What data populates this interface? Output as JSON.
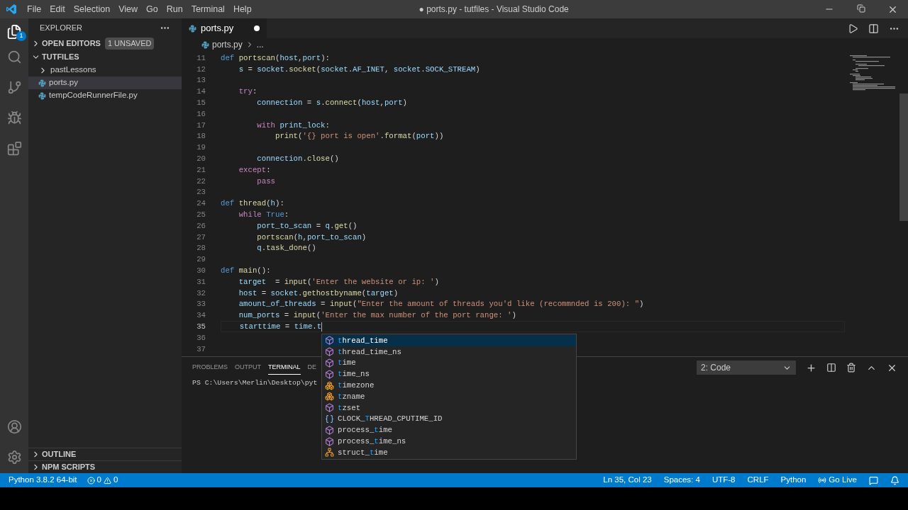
{
  "window": {
    "title": "● ports.py - tutfiles - Visual Studio Code"
  },
  "menu": [
    "File",
    "Edit",
    "Selection",
    "View",
    "Go",
    "Run",
    "Terminal",
    "Help"
  ],
  "activity_badge": "1",
  "sidebar": {
    "header": "EXPLORER",
    "sections": [
      {
        "label": "OPEN EDITORS",
        "expanded": false,
        "badge": "1 UNSAVED"
      },
      {
        "label": "TUTFILES",
        "expanded": true
      }
    ],
    "items": [
      {
        "label": "pastLessons",
        "kind": "folder",
        "selected": false
      },
      {
        "label": "ports.py",
        "kind": "python",
        "selected": true
      },
      {
        "label": "tempCodeRunnerFile.py",
        "kind": "python",
        "selected": false
      }
    ],
    "bottom_sections": [
      {
        "label": "OUTLINE",
        "expanded": false
      },
      {
        "label": "NPM SCRIPTS",
        "expanded": false
      }
    ]
  },
  "tab": {
    "label": "ports.py",
    "dirty": true
  },
  "breadcrumb": [
    "ports.py",
    "..."
  ],
  "code": [
    {
      "n": "11",
      "tokens": [
        {
          "kind": "keyword",
          "text": "def "
        },
        {
          "kind": "function",
          "text": "portscan"
        },
        {
          "kind": "plain",
          "text": "("
        },
        {
          "kind": "variable",
          "text": "host"
        },
        {
          "kind": "plain",
          "text": ","
        },
        {
          "kind": "variable",
          "text": "port"
        },
        {
          "kind": "plain",
          "text": "):"
        }
      ]
    },
    {
      "n": "12",
      "tokens": [
        {
          "kind": "variable",
          "text": "    s"
        },
        {
          "kind": "plain",
          "text": " = "
        },
        {
          "kind": "variable",
          "text": "socket"
        },
        {
          "kind": "plain",
          "text": "."
        },
        {
          "kind": "function",
          "text": "socket"
        },
        {
          "kind": "plain",
          "text": "("
        },
        {
          "kind": "variable",
          "text": "socket"
        },
        {
          "kind": "plain",
          "text": "."
        },
        {
          "kind": "variable",
          "text": "AF_INET"
        },
        {
          "kind": "plain",
          "text": ", "
        },
        {
          "kind": "variable",
          "text": "socket"
        },
        {
          "kind": "plain",
          "text": "."
        },
        {
          "kind": "variable",
          "text": "SOCK_STREAM"
        },
        {
          "kind": "plain",
          "text": ")"
        }
      ]
    },
    {
      "n": "13"
    },
    {
      "n": "14",
      "tokens": [
        {
          "kind": "control",
          "text": "    try"
        },
        {
          "kind": "plain",
          "text": ":"
        }
      ]
    },
    {
      "n": "15",
      "tokens": [
        {
          "kind": "variable",
          "text": "        connection"
        },
        {
          "kind": "plain",
          "text": " = "
        },
        {
          "kind": "variable",
          "text": "s"
        },
        {
          "kind": "plain",
          "text": "."
        },
        {
          "kind": "function",
          "text": "connect"
        },
        {
          "kind": "plain",
          "text": "("
        },
        {
          "kind": "variable",
          "text": "host"
        },
        {
          "kind": "plain",
          "text": ","
        },
        {
          "kind": "variable",
          "text": "port"
        },
        {
          "kind": "plain",
          "text": ")"
        }
      ]
    },
    {
      "n": "16"
    },
    {
      "n": "17",
      "tokens": [
        {
          "kind": "control",
          "text": "        with "
        },
        {
          "kind": "variable",
          "text": "print_lock"
        },
        {
          "kind": "plain",
          "text": ":"
        }
      ]
    },
    {
      "n": "18",
      "tokens": [
        {
          "kind": "function",
          "text": "            print"
        },
        {
          "kind": "plain",
          "text": "("
        },
        {
          "kind": "string",
          "text": "'{} port is open'"
        },
        {
          "kind": "plain",
          "text": "."
        },
        {
          "kind": "function",
          "text": "format"
        },
        {
          "kind": "plain",
          "text": "("
        },
        {
          "kind": "variable",
          "text": "port"
        },
        {
          "kind": "plain",
          "text": "))"
        }
      ]
    },
    {
      "n": "19"
    },
    {
      "n": "20",
      "tokens": [
        {
          "kind": "variable",
          "text": "        connection"
        },
        {
          "kind": "plain",
          "text": "."
        },
        {
          "kind": "function",
          "text": "close"
        },
        {
          "kind": "plain",
          "text": "()"
        }
      ]
    },
    {
      "n": "21",
      "tokens": [
        {
          "kind": "control",
          "text": "    except"
        },
        {
          "kind": "plain",
          "text": ":"
        }
      ]
    },
    {
      "n": "22",
      "tokens": [
        {
          "kind": "control",
          "text": "        pass"
        }
      ]
    },
    {
      "n": "23"
    },
    {
      "n": "24",
      "tokens": [
        {
          "kind": "keyword",
          "text": "def "
        },
        {
          "kind": "function",
          "text": "thread"
        },
        {
          "kind": "plain",
          "text": "("
        },
        {
          "kind": "variable",
          "text": "h"
        },
        {
          "kind": "plain",
          "text": "):"
        }
      ]
    },
    {
      "n": "25",
      "tokens": [
        {
          "kind": "control",
          "text": "    while "
        },
        {
          "kind": "keyword",
          "text": "True"
        },
        {
          "kind": "plain",
          "text": ":"
        }
      ]
    },
    {
      "n": "26",
      "tokens": [
        {
          "kind": "variable",
          "text": "        port_to_scan"
        },
        {
          "kind": "plain",
          "text": " = "
        },
        {
          "kind": "variable",
          "text": "q"
        },
        {
          "kind": "plain",
          "text": "."
        },
        {
          "kind": "function",
          "text": "get"
        },
        {
          "kind": "plain",
          "text": "()"
        }
      ]
    },
    {
      "n": "27",
      "tokens": [
        {
          "kind": "function",
          "text": "        portscan"
        },
        {
          "kind": "plain",
          "text": "("
        },
        {
          "kind": "variable",
          "text": "h"
        },
        {
          "kind": "plain",
          "text": ","
        },
        {
          "kind": "variable",
          "text": "port_to_scan"
        },
        {
          "kind": "plain",
          "text": ")"
        }
      ]
    },
    {
      "n": "28",
      "tokens": [
        {
          "kind": "variable",
          "text": "        q"
        },
        {
          "kind": "plain",
          "text": "."
        },
        {
          "kind": "function",
          "text": "task_done"
        },
        {
          "kind": "plain",
          "text": "()"
        }
      ]
    },
    {
      "n": "29"
    },
    {
      "n": "30",
      "tokens": [
        {
          "kind": "keyword",
          "text": "def "
        },
        {
          "kind": "function",
          "text": "main"
        },
        {
          "kind": "plain",
          "text": "():"
        }
      ]
    },
    {
      "n": "31",
      "tokens": [
        {
          "kind": "variable",
          "text": "    target"
        },
        {
          "kind": "plain",
          "text": "  = "
        },
        {
          "kind": "function",
          "text": "input"
        },
        {
          "kind": "plain",
          "text": "("
        },
        {
          "kind": "string",
          "text": "'Enter the website or ip: '"
        },
        {
          "kind": "plain",
          "text": ")"
        }
      ]
    },
    {
      "n": "32",
      "tokens": [
        {
          "kind": "variable",
          "text": "    host"
        },
        {
          "kind": "plain",
          "text": " = "
        },
        {
          "kind": "variable",
          "text": "socket"
        },
        {
          "kind": "plain",
          "text": "."
        },
        {
          "kind": "function",
          "text": "gethostbyname"
        },
        {
          "kind": "plain",
          "text": "("
        },
        {
          "kind": "variable",
          "text": "target"
        },
        {
          "kind": "plain",
          "text": ")"
        }
      ]
    },
    {
      "n": "33",
      "tokens": [
        {
          "kind": "variable",
          "text": "    amount_of_threads"
        },
        {
          "kind": "plain",
          "text": " = "
        },
        {
          "kind": "function",
          "text": "input"
        },
        {
          "kind": "plain",
          "text": "("
        },
        {
          "kind": "string",
          "text": "\"Enter the amount of threads you'd like (recommnded is 200): \""
        },
        {
          "kind": "plain",
          "text": ")"
        }
      ]
    },
    {
      "n": "34",
      "tokens": [
        {
          "kind": "variable",
          "text": "    num_ports"
        },
        {
          "kind": "plain",
          "text": " = "
        },
        {
          "kind": "function",
          "text": "input"
        },
        {
          "kind": "plain",
          "text": "("
        },
        {
          "kind": "string",
          "text": "'Enter the max number of the port range: '"
        },
        {
          "kind": "plain",
          "text": ")"
        }
      ]
    },
    {
      "n": "35",
      "tokens": [
        {
          "kind": "variable",
          "text": "    starttime"
        },
        {
          "kind": "plain",
          "text": " = "
        },
        {
          "kind": "variable",
          "text": "time"
        },
        {
          "kind": "plain",
          "text": "."
        },
        {
          "kind": "variable",
          "text": "t"
        }
      ],
      "current": true
    },
    {
      "n": "36"
    },
    {
      "n": "37"
    }
  ],
  "suggestions": [
    {
      "match": "t",
      "post": "hread_time",
      "kind": "method",
      "selected": true
    },
    {
      "match": "t",
      "post": "hread_time_ns",
      "kind": "method",
      "selected": false
    },
    {
      "match": "t",
      "post": "ime",
      "kind": "method",
      "selected": false
    },
    {
      "match": "t",
      "post": "ime_ns",
      "kind": "method",
      "selected": false
    },
    {
      "match": "t",
      "post": "imezone",
      "kind": "field",
      "selected": false
    },
    {
      "match": "t",
      "post": "zname",
      "kind": "field",
      "selected": false
    },
    {
      "match": "t",
      "post": "zset",
      "kind": "method",
      "selected": false
    },
    {
      "pre": "CLOCK_",
      "match": "T",
      "post": "HREAD_CPUTIME_ID",
      "kind": "constant",
      "selected": false
    },
    {
      "pre": "process_",
      "match": "t",
      "post": "ime",
      "kind": "method",
      "selected": false
    },
    {
      "pre": "process_",
      "match": "t",
      "post": "ime_ns",
      "kind": "method",
      "selected": false
    },
    {
      "pre": "struct_",
      "match": "t",
      "post": "ime",
      "kind": "class",
      "selected": false
    }
  ],
  "panel": {
    "tabs": [
      {
        "label": "PROBLEMS",
        "selected": false
      },
      {
        "label": "OUTPUT",
        "selected": false
      },
      {
        "label": "TERMINAL",
        "selected": true
      },
      {
        "label": "DE",
        "selected": false
      }
    ],
    "terminal_select": "2: Code",
    "terminal_text": "PS C:\\Users\\Merlin\\Desktop\\pyt"
  },
  "status_bar": {
    "interpreter": "Python 3.8.2 64-bit",
    "errors": "0",
    "warnings": "0",
    "right": [
      "Ln 35, Col 23",
      "Spaces: 4",
      "UTF-8",
      "CRLF",
      "Python"
    ],
    "live": "Go Live"
  }
}
